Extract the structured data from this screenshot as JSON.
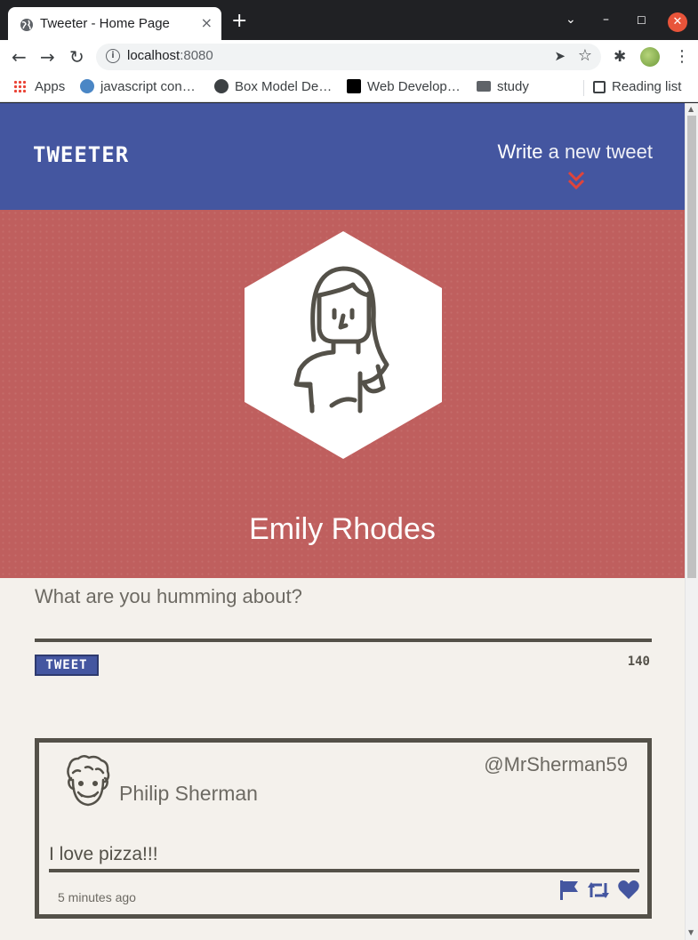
{
  "browser": {
    "tab_title": "Tweeter - Home Page",
    "tab_close": "×",
    "new_tab": "+",
    "url_host": "localhost",
    "url_port": ":8080",
    "bookmarks": [
      {
        "label": "Apps"
      },
      {
        "label": "javascript con…"
      },
      {
        "label": "Box Model De…"
      },
      {
        "label": "Web Develop…"
      },
      {
        "label": "study"
      }
    ],
    "reading_list": "Reading list"
  },
  "nav": {
    "brand": "TWEETER",
    "compose_write": "Write",
    "compose_rest": " a new tweet"
  },
  "profile": {
    "name": "Emily Rhodes"
  },
  "new_tweet": {
    "placeholder": "What are you humming about?",
    "button": "TWEET",
    "counter": "140"
  },
  "tweets": [
    {
      "name": "Philip Sherman",
      "handle": "@MrSherman59",
      "content": "I love pizza!!!",
      "time": "5 minutes ago"
    }
  ],
  "colors": {
    "nav": "#4456a0",
    "header": "#bf5f5e",
    "page": "#f4f1ec",
    "text": "#545149",
    "accent": "#e8543a"
  }
}
